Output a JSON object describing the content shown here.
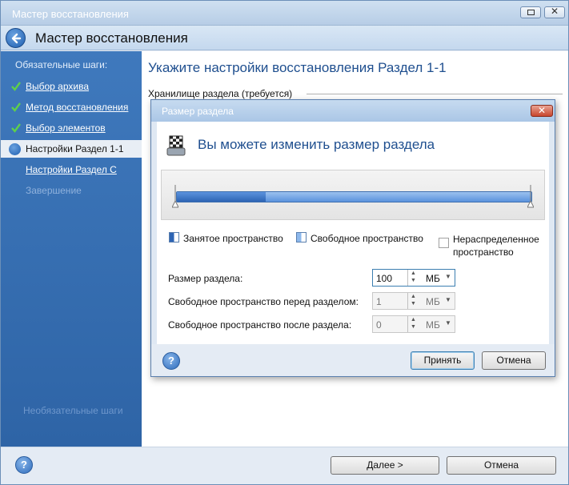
{
  "window": {
    "title": "Мастер восстановления",
    "header_title": "Мастер восстановления"
  },
  "sidebar": {
    "heading": "Обязательные шаги:",
    "steps": [
      {
        "label": "Выбор архива",
        "state": "done"
      },
      {
        "label": "Метод восстановления",
        "state": "done"
      },
      {
        "label": "Выбор элементов",
        "state": "done"
      },
      {
        "label": "Настройки Раздел 1-1",
        "state": "active"
      },
      {
        "label": "Настройки Раздел C",
        "state": "pending"
      },
      {
        "label": "Завершение",
        "state": "disabled"
      }
    ],
    "optional_heading_faded": "Необязательные шаги"
  },
  "content": {
    "title": "Укажите настройки восстановления Раздел 1-1",
    "subtitle": "Хранилище раздела (требуется)"
  },
  "footer": {
    "next_label": "Далее >",
    "cancel_label": "Отмена"
  },
  "dialog": {
    "title": "Размер раздела",
    "close_glyph": "✕",
    "heading": "Вы можете изменить размер раздела",
    "bar": {
      "used_fraction": 0.25
    },
    "legend": {
      "used": "Занятое пространство",
      "free": "Свободное пространство",
      "unallocated": "Нераспределенное пространство"
    },
    "fields": {
      "size": {
        "label": "Размер раздела:",
        "value": "100",
        "unit": "МБ"
      },
      "before": {
        "label": "Свободное пространство перед разделом:",
        "value": "1",
        "unit": "МБ"
      },
      "after": {
        "label": "Свободное пространство после раздела:",
        "value": "0",
        "unit": "МБ"
      }
    },
    "ok_label": "Принять",
    "cancel_label": "Отмена"
  },
  "colors": {
    "sidebar": "#3a72b6",
    "accent_title": "#1f4f8f",
    "bar_used": "#2d64b4",
    "bar_free": "#8db8ec"
  }
}
